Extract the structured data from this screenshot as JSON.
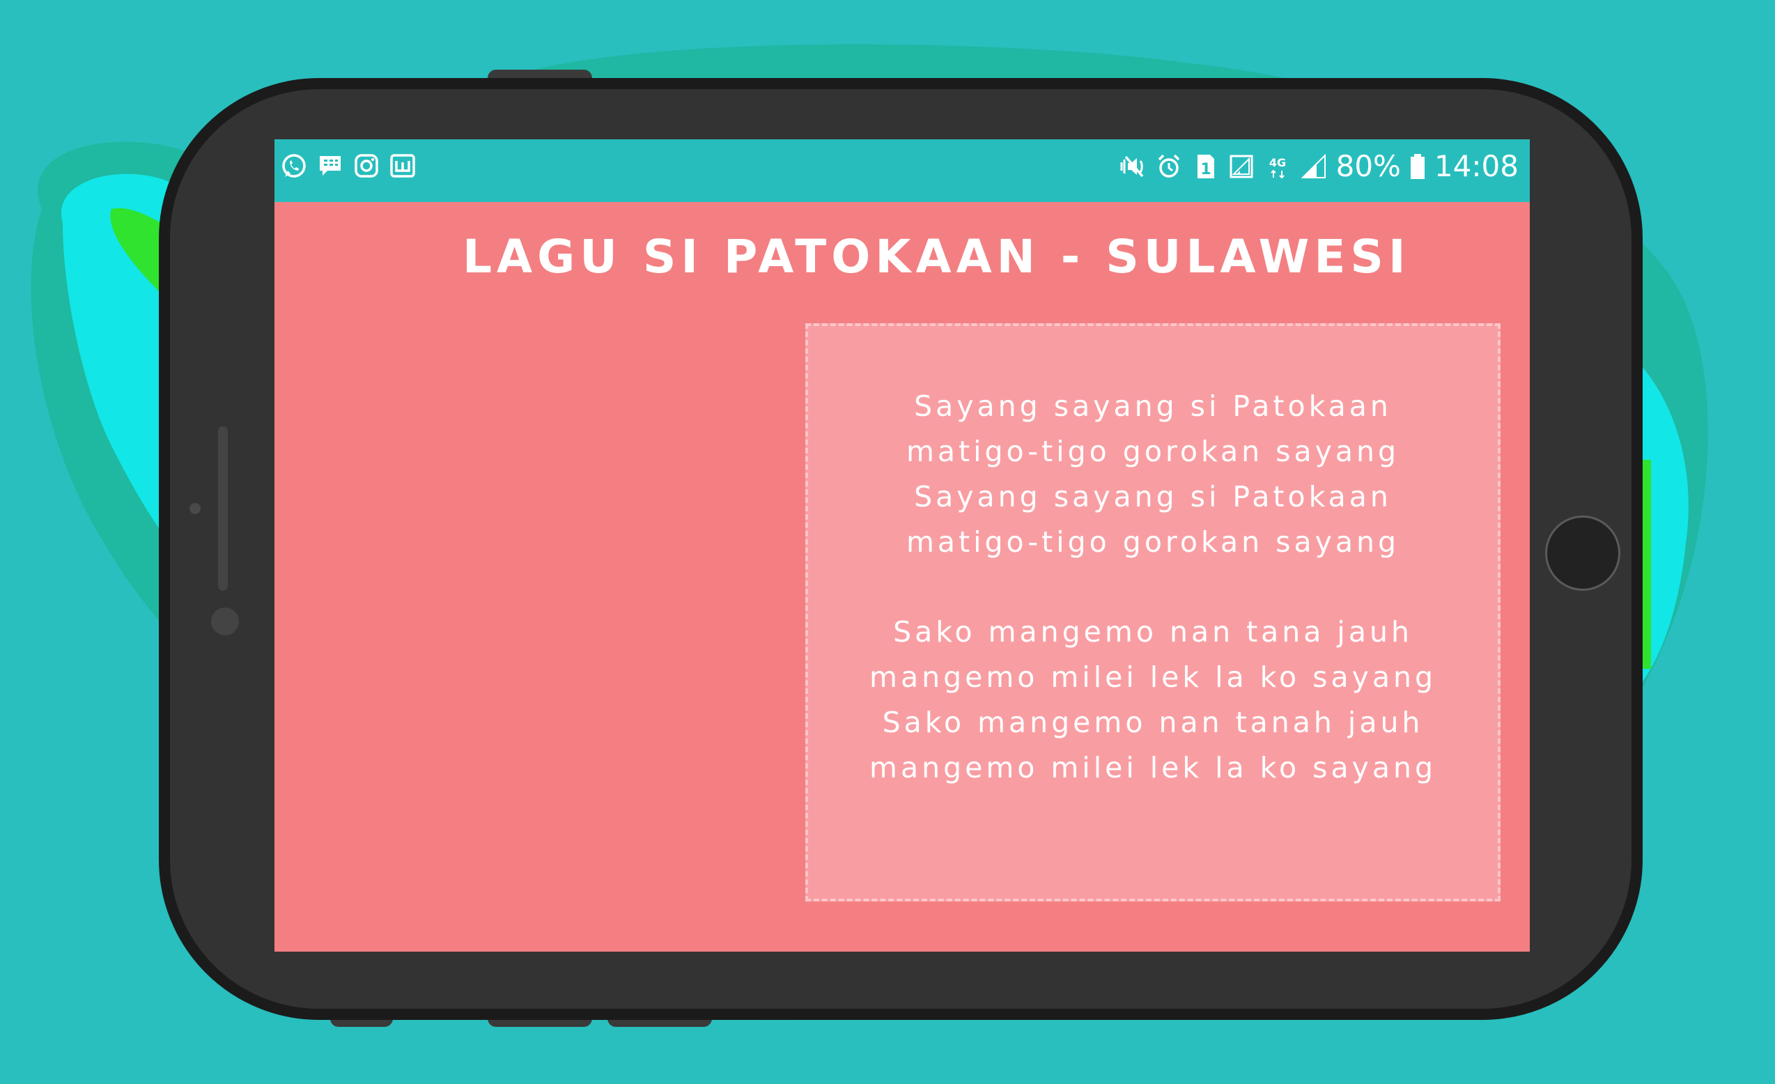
{
  "app": {
    "title": "LAGU SI PATOKAAN - SULAWESI"
  },
  "status_bar": {
    "left_icons": [
      "whatsapp-icon",
      "bbm-icon",
      "instagram-icon",
      "wattpad-icon"
    ],
    "right_icons": [
      "vibrate-mute-icon",
      "alarm-icon",
      "sim-1-icon",
      "signal-icon",
      "network-4g-icon",
      "signal-icon",
      "battery-icon"
    ],
    "network_label": "4G",
    "sim_label": "1",
    "battery": "80%",
    "time": "14:08"
  },
  "lyrics": {
    "stanza_1": [
      "Sayang sayang si Patokaan",
      "matigo-tigo gorokan sayang",
      "Sayang sayang si Patokaan",
      "matigo-tigo gorokan sayang"
    ],
    "stanza_2": [
      "Sako mangemo nan tana jauh",
      "mangemo milei lek la ko sayang",
      "Sako mangemo nan tanah jauh",
      "mangemo milei lek la ko sayang"
    ]
  },
  "colors": {
    "background": "#28bfbe",
    "phone_body": "#333333",
    "screen": "#f37f82",
    "status_bar": "#28bdbd",
    "lyrics_box": "#f89ea3",
    "text": "#ffffff"
  }
}
